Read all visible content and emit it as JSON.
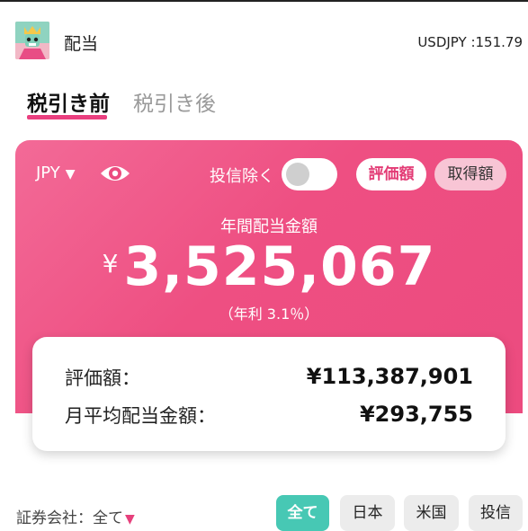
{
  "header": {
    "title": "配当",
    "fx_rate": "USDJPY :151.79"
  },
  "tabs": [
    {
      "label": "税引き前",
      "active": true
    },
    {
      "label": "税引き後",
      "active": false
    }
  ],
  "card": {
    "currency": "JPY",
    "exclude_funds_label": "投信除く",
    "exclude_funds_on": false,
    "basis_toggle": [
      "評価額",
      "取得額"
    ],
    "basis_selected": "評価額",
    "annual_label": "年間配当金額",
    "yen_symbol": "¥",
    "annual_amount": "3,525,067",
    "yield_text": "（年利 3.1％）"
  },
  "summary": {
    "valuation_label": "評価額：",
    "valuation_value": "¥113,387,901",
    "monthly_label": "月平均配当金額：",
    "monthly_value": "¥293,755"
  },
  "filter": {
    "broker_label": "証券会社：全て",
    "chips": [
      "全て",
      "日本",
      "米国",
      "投信"
    ],
    "selected": "全て"
  },
  "colors": {
    "accent_pink": "#ec4b7f",
    "tab_underline": "#ea3f7f",
    "chip_selected": "#47c8b4"
  },
  "icons": [
    "avatar-icon",
    "eye-icon",
    "dropdown-caret-icon"
  ]
}
